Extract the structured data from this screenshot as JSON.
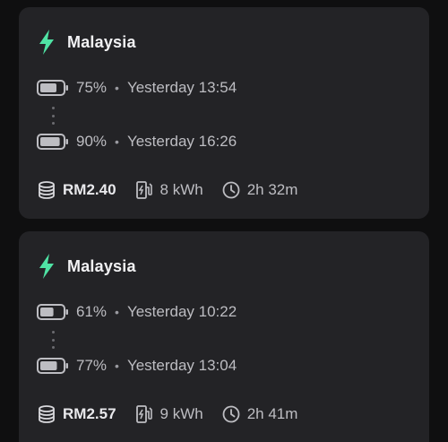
{
  "colors": {
    "accent": "#4fe3a4",
    "card_bg": "#232326",
    "page_bg": "#0f0f10"
  },
  "sessions": [
    {
      "location": "Malaysia",
      "start": {
        "percent": "75%",
        "time": "Yesterday 13:54",
        "level": 0.75
      },
      "end": {
        "percent": "90%",
        "time": "Yesterday 16:26",
        "level": 0.9
      },
      "cost": "RM2.40",
      "energy": "8 kWh",
      "duration": "2h 32m"
    },
    {
      "location": "Malaysia",
      "start": {
        "percent": "61%",
        "time": "Yesterday 10:22",
        "level": 0.61
      },
      "end": {
        "percent": "77%",
        "time": "Yesterday 13:04",
        "level": 0.77
      },
      "cost": "RM2.57",
      "energy": "9 kWh",
      "duration": "2h 41m"
    }
  ],
  "icons": {
    "location": "lightning-bolt-icon",
    "battery": "battery-icon",
    "cost": "coins-icon",
    "energy": "ev-charger-icon",
    "duration": "clock-icon"
  }
}
